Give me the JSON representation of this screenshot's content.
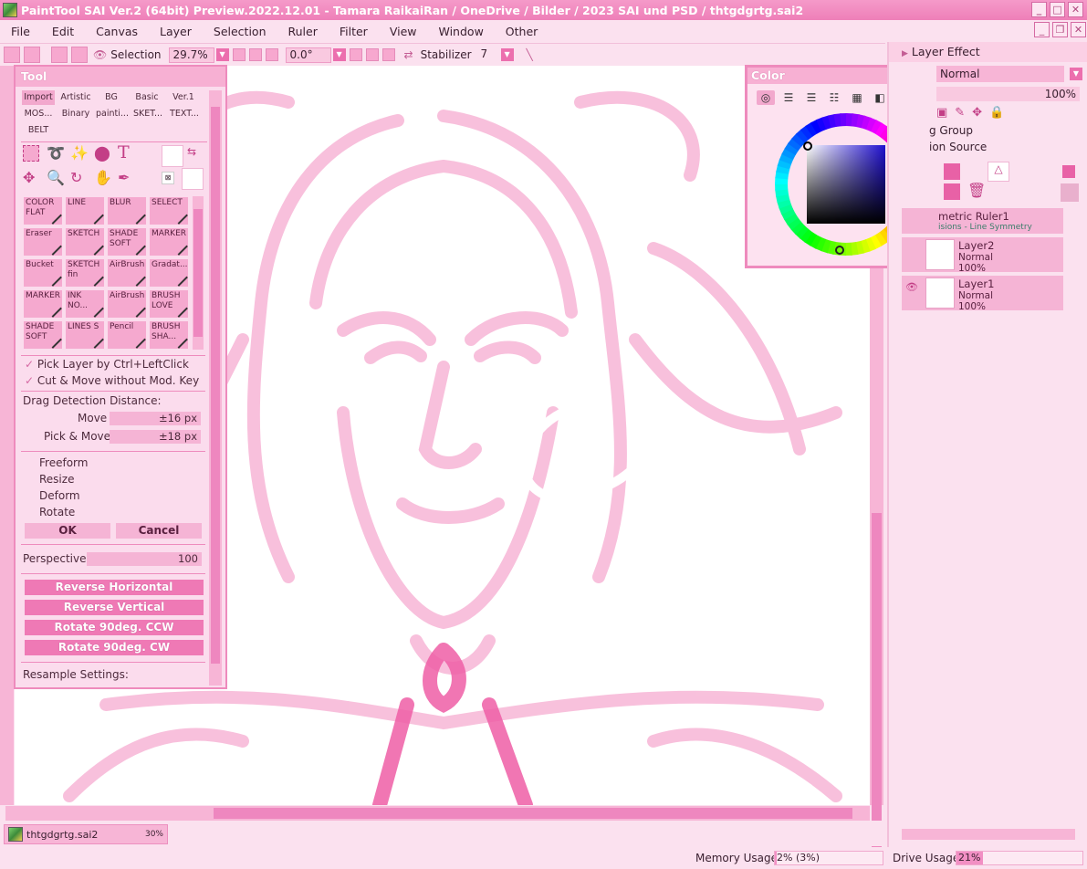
{
  "title": "PaintTool SAI Ver.2 (64bit) Preview.2022.12.01 - Tamara RaikaiRan / OneDrive / Bilder / 2023 SAI und PSD / thtgdgrtg.sai2",
  "menu": [
    "File",
    "Edit",
    "Canvas",
    "Layer",
    "Selection",
    "Ruler",
    "Filter",
    "View",
    "Window",
    "Other"
  ],
  "toolbar": {
    "selection_label": "Selection",
    "zoom": "29.7%",
    "angle": "0.0°",
    "stabilizer_label": "Stabilizer",
    "stabilizer_value": "7"
  },
  "tool_panel": {
    "title": "Tool",
    "brush_sets_row1": [
      "Import",
      "Artistic",
      "BG",
      "Basic",
      "Ver.1"
    ],
    "brush_sets_row2": [
      "MOS...",
      "Binary",
      "painti...",
      "SKET...",
      "TEXT..."
    ],
    "brush_sets_row3": [
      "BELT"
    ],
    "brushes": [
      [
        "COLOR FLAT",
        "LINE",
        "BLUR",
        "SELECT"
      ],
      [
        "Eraser",
        "SKETCH",
        "SHADE SOFT",
        "MARKER"
      ],
      [
        "Bucket",
        "SKETCH fin",
        "AirBrush",
        "Gradat..."
      ],
      [
        "MARKER",
        "INK NO...",
        "AirBrush",
        "BRUSH LOVE"
      ],
      [
        "SHADE SOFT",
        "LINES S",
        "Pencil",
        "BRUSH SHA..."
      ]
    ],
    "pick_layer": "Pick Layer by Ctrl+LeftClick",
    "cut_move": "Cut & Move without Mod. Key",
    "drag_detection": "Drag Detection Distance:",
    "move_label": "Move",
    "move_value": "±16 px",
    "pick_move_label": "Pick & Move",
    "pick_move_value": "±18 px",
    "modes": [
      "Freeform",
      "Resize",
      "Deform",
      "Rotate"
    ],
    "ok": "OK",
    "cancel": "Cancel",
    "perspective_label": "Perspective",
    "perspective_value": "100",
    "reverse_h": "Reverse Horizontal",
    "reverse_v": "Reverse Vertical",
    "rotate_ccw": "Rotate 90deg. CCW",
    "rotate_cw": "Rotate 90deg. CW",
    "resample": "Resample Settings:"
  },
  "color_panel": {
    "title": "Color"
  },
  "right_panel": {
    "layer_effect": "Layer Effect",
    "blend_mode": "Normal",
    "opacity": "100%",
    "clip_group": "g Group",
    "selection_source": "ion Source",
    "layers": [
      {
        "name": "metric Ruler1",
        "sub": "isions - Line Symmetry"
      },
      {
        "name": "Layer2",
        "mode": "Normal",
        "opacity": "100%"
      },
      {
        "name": "Layer1",
        "mode": "Normal",
        "opacity": "100%"
      }
    ]
  },
  "document_tab": {
    "name": "thtgdgrtg.sai2",
    "zoom": "30%"
  },
  "status": {
    "memory_label": "Memory Usage",
    "memory_value": "2% (3%)",
    "memory_fraction": 0.02,
    "drive_label": "Drive Usage",
    "drive_value": "21%",
    "drive_fraction": 0.21
  },
  "colors": {
    "accent": "#ee7fb8",
    "panel": "#fbdced",
    "button": "#ef79b5"
  }
}
